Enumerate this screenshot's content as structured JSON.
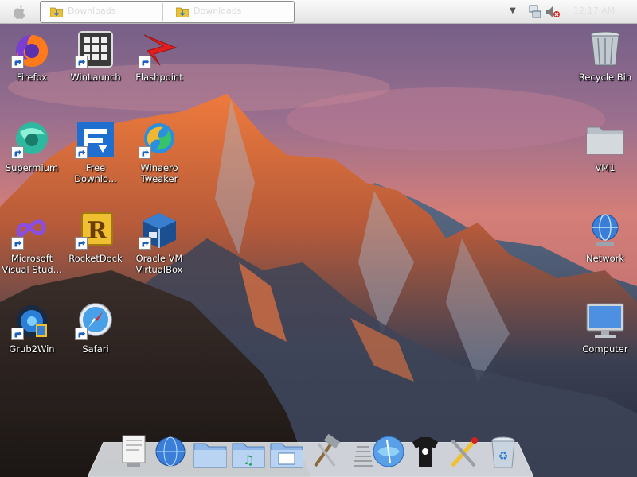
{
  "menubar": {
    "apple_icon": "apple-logo-icon",
    "taskbar_buttons": [
      {
        "label": "Downloads",
        "icon": "folder-download-icon"
      },
      {
        "label": "Downloads",
        "icon": "folder-download-icon"
      }
    ],
    "tray": {
      "chevron_icon": "chevron-down-icon",
      "network_icon": "network-tray-icon",
      "volume_icon": "volume-muted-icon",
      "clock": "12:17 AM"
    }
  },
  "desktop": {
    "icons": [
      {
        "id": "firefox",
        "label": "Firefox",
        "icon": "firefox-icon",
        "shortcut": true
      },
      {
        "id": "winlaunch",
        "label": "WinLaunch",
        "icon": "winlaunch-icon",
        "shortcut": true
      },
      {
        "id": "flashpoint",
        "label": "Flashpoint",
        "icon": "flashpoint-icon",
        "shortcut": true
      },
      {
        "id": "supermium",
        "label": "Supermium",
        "icon": "supermium-icon",
        "shortcut": true
      },
      {
        "id": "fdm",
        "label": "Free\nDownlo...",
        "icon": "free-download-manager-icon",
        "shortcut": true
      },
      {
        "id": "winaero",
        "label": "Winaero\nTweaker",
        "icon": "winaero-tweaker-icon",
        "shortcut": true
      },
      {
        "id": "vs",
        "label": "Microsoft\nVisual Stud...",
        "icon": "visual-studio-icon",
        "shortcut": true
      },
      {
        "id": "rocketdock",
        "label": "RocketDock",
        "icon": "rocketdock-icon",
        "shortcut": true
      },
      {
        "id": "virtualbox",
        "label": "Oracle VM\nVirtualBox",
        "icon": "virtualbox-icon",
        "shortcut": true
      },
      {
        "id": "grub2win",
        "label": "Grub2Win",
        "icon": "grub2win-icon",
        "shortcut": true
      },
      {
        "id": "safari",
        "label": "Safari",
        "icon": "safari-icon",
        "shortcut": true
      },
      {
        "id": "recyclebin",
        "label": "Recycle Bin",
        "icon": "recycle-bin-icon",
        "shortcut": false
      },
      {
        "id": "vm1",
        "label": "VM1",
        "icon": "folder-icon",
        "shortcut": false
      },
      {
        "id": "network",
        "label": "Network",
        "icon": "network-globe-icon",
        "shortcut": false
      },
      {
        "id": "computer",
        "label": "Computer",
        "icon": "computer-monitor-icon",
        "shortcut": false
      }
    ]
  },
  "dock": {
    "items": [
      "preview-document-icon",
      "network-globe-icon",
      "folder-icon",
      "music-folder-icon",
      "pictures-folder-icon",
      "tools-hammer-icon",
      "separator",
      "browser-globe-icon",
      "tshirt-icon",
      "utilities-tools-icon",
      "trash-icon"
    ]
  },
  "colors": {
    "menubar_bg": "#ececec",
    "label_text": "#ffffff",
    "sky_top": "#7a6488",
    "sky_horizon": "#e0816a",
    "mountain_lit": "#e8743f"
  }
}
